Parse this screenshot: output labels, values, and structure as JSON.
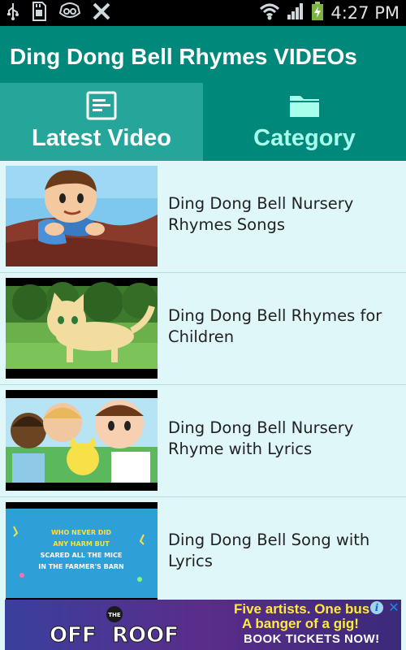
{
  "status_bar": {
    "time": "4:27 PM",
    "icons": [
      "usb-icon",
      "sd-card-icon",
      "voicemail-icon",
      "missed-call-icon",
      "wifi-icon",
      "signal-icon",
      "battery-charging-icon"
    ]
  },
  "app_bar": {
    "title": "Ding Dong Bell Rhymes VIDEOs"
  },
  "tabs": [
    {
      "label": "Latest Video",
      "icon": "video-list-icon",
      "selected": true
    },
    {
      "label": "Category",
      "icon": "folder-icon",
      "selected": false
    }
  ],
  "videos": [
    {
      "title": "Ding Dong Bell Nursery Rhymes Songs"
    },
    {
      "title": "Ding Dong Bell Rhymes for Children"
    },
    {
      "title": "Ding Dong Bell Nursery Rhyme with Lyrics"
    },
    {
      "title": "Ding Dong Bell Song with Lyrics"
    }
  ],
  "thumb4_text": [
    "WHO NEVER DID",
    "ANY HARM BUT",
    "SCARED ALL THE MICE",
    "IN THE FARMER'S BARN"
  ],
  "ad": {
    "logo_top": "THE",
    "logo_main_left": "OFF",
    "logo_main_right": "ROOF",
    "line1": "Five artists. One bus",
    "line2": "A banger of a gig!",
    "cta": "BOOK TICKETS NOW!",
    "info": "i",
    "close": "✕"
  },
  "colors": {
    "status_bar": "#000000",
    "app_bar": "#00897b",
    "tab_selected": "#26a69a",
    "tab_unselected": "#00897b",
    "tab_unselected_text": "#a7ffeb",
    "list_background": "#e0f7fa"
  }
}
